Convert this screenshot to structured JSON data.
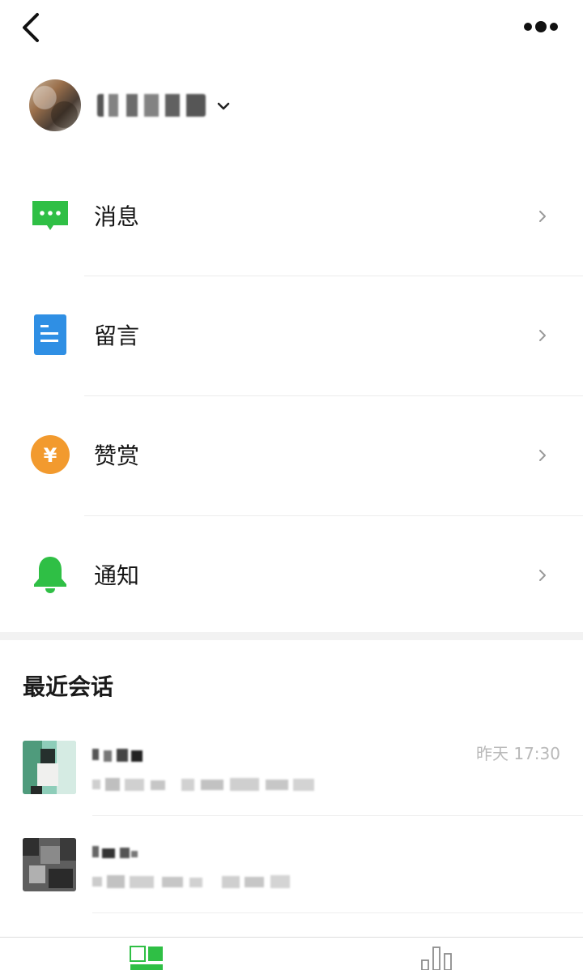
{
  "menu": {
    "items": [
      {
        "label": "消息"
      },
      {
        "label": "留言"
      },
      {
        "label": "赞赏"
      },
      {
        "label": "通知"
      }
    ]
  },
  "recent": {
    "title": "最近会话",
    "conversations": [
      {
        "time": "昨天 17:30"
      },
      {
        "time": ""
      }
    ]
  },
  "colors": {
    "accent_green": "#2fbf45",
    "blue": "#2f8fe4",
    "orange": "#f29a2e"
  },
  "icons": {
    "back": "chevron-left-icon",
    "more": "ellipsis-icon",
    "message": "chat-bubble-icon",
    "comment": "document-icon",
    "reward": "yen-coin-icon",
    "notice": "bell-icon",
    "chevron": "chevron-right-icon",
    "tab_home": "grid-icon",
    "tab_stats": "bar-chart-icon"
  }
}
